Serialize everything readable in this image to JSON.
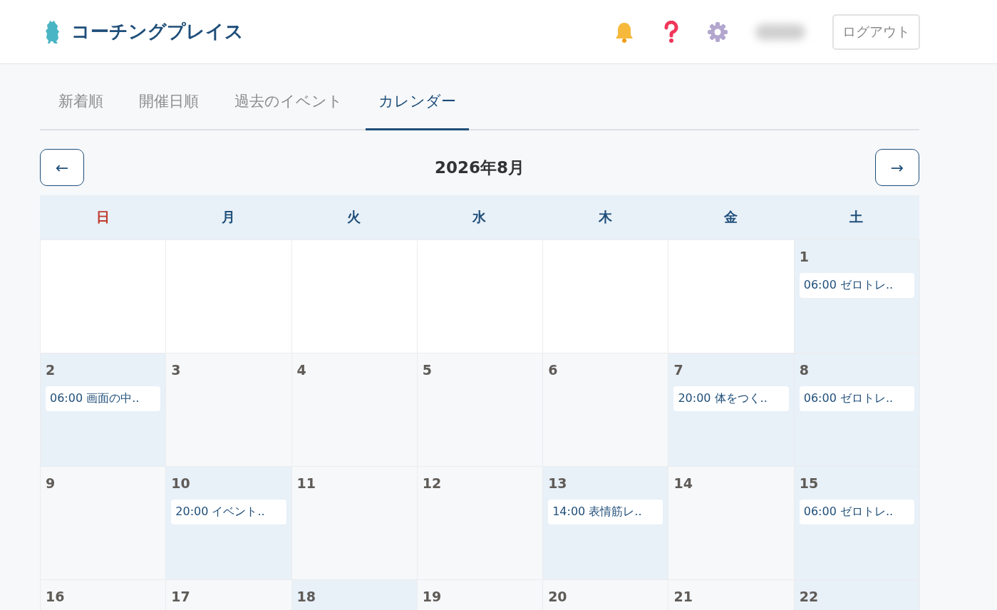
{
  "header": {
    "app_name": "コーチングプレイス",
    "logout_button": "ログアウト"
  },
  "tabs": [
    {
      "label": "新着順",
      "selected": false
    },
    {
      "label": "開催日順",
      "selected": false
    },
    {
      "label": "過去のイベント",
      "selected": false
    },
    {
      "label": "カレンダー",
      "selected": true
    }
  ],
  "calendar": {
    "prev_button": "←",
    "next_button": "→",
    "month": "2026年8月",
    "weekdays": [
      {
        "label": "日",
        "color": "#c0392b"
      },
      {
        "label": "月",
        "color": "#1f4e79"
      },
      {
        "label": "火",
        "color": "#1f4e79"
      },
      {
        "label": "水",
        "color": "#1f4e79"
      },
      {
        "label": "木",
        "color": "#1f4e79"
      },
      {
        "label": "金",
        "color": "#1f4e79"
      },
      {
        "label": "土",
        "color": "#1f4e79"
      }
    ],
    "cells": [
      {
        "kind": "blank"
      },
      {
        "kind": "blank"
      },
      {
        "kind": "blank"
      },
      {
        "kind": "blank"
      },
      {
        "kind": "blank"
      },
      {
        "kind": "blank"
      },
      {
        "kind": "day",
        "day": "1",
        "highlighted": true,
        "events": [
          "06:00 ゼロトレ.."
        ]
      },
      {
        "kind": "day",
        "day": "2",
        "highlighted": true,
        "events": [
          "06:00 画面の中.."
        ]
      },
      {
        "kind": "day",
        "day": "3",
        "highlighted": false
      },
      {
        "kind": "day",
        "day": "4",
        "highlighted": false
      },
      {
        "kind": "day",
        "day": "5",
        "highlighted": false
      },
      {
        "kind": "day",
        "day": "6",
        "highlighted": false
      },
      {
        "kind": "day",
        "day": "7",
        "highlighted": true,
        "events": [
          "20:00 体をつく.."
        ]
      },
      {
        "kind": "day",
        "day": "8",
        "highlighted": true,
        "events": [
          "06:00 ゼロトレ.."
        ]
      },
      {
        "kind": "day",
        "day": "9",
        "highlighted": false
      },
      {
        "kind": "day",
        "day": "10",
        "highlighted": true,
        "events": [
          "20:00 イベント.."
        ]
      },
      {
        "kind": "day",
        "day": "11",
        "highlighted": false
      },
      {
        "kind": "day",
        "day": "12",
        "highlighted": false
      },
      {
        "kind": "day",
        "day": "13",
        "highlighted": true,
        "events": [
          "14:00 表情筋レ.."
        ]
      },
      {
        "kind": "day",
        "day": "14",
        "highlighted": false
      },
      {
        "kind": "day",
        "day": "15",
        "highlighted": true,
        "events": [
          "06:00 ゼロトレ.."
        ]
      },
      {
        "kind": "day",
        "day": "16",
        "highlighted": false
      },
      {
        "kind": "day",
        "day": "17",
        "highlighted": false
      },
      {
        "kind": "day",
        "day": "18",
        "highlighted": true
      },
      {
        "kind": "day",
        "day": "19",
        "highlighted": false
      },
      {
        "kind": "day",
        "day": "20",
        "highlighted": false
      },
      {
        "kind": "day",
        "day": "21",
        "highlighted": false
      },
      {
        "kind": "day",
        "day": "22",
        "highlighted": true
      }
    ]
  }
}
